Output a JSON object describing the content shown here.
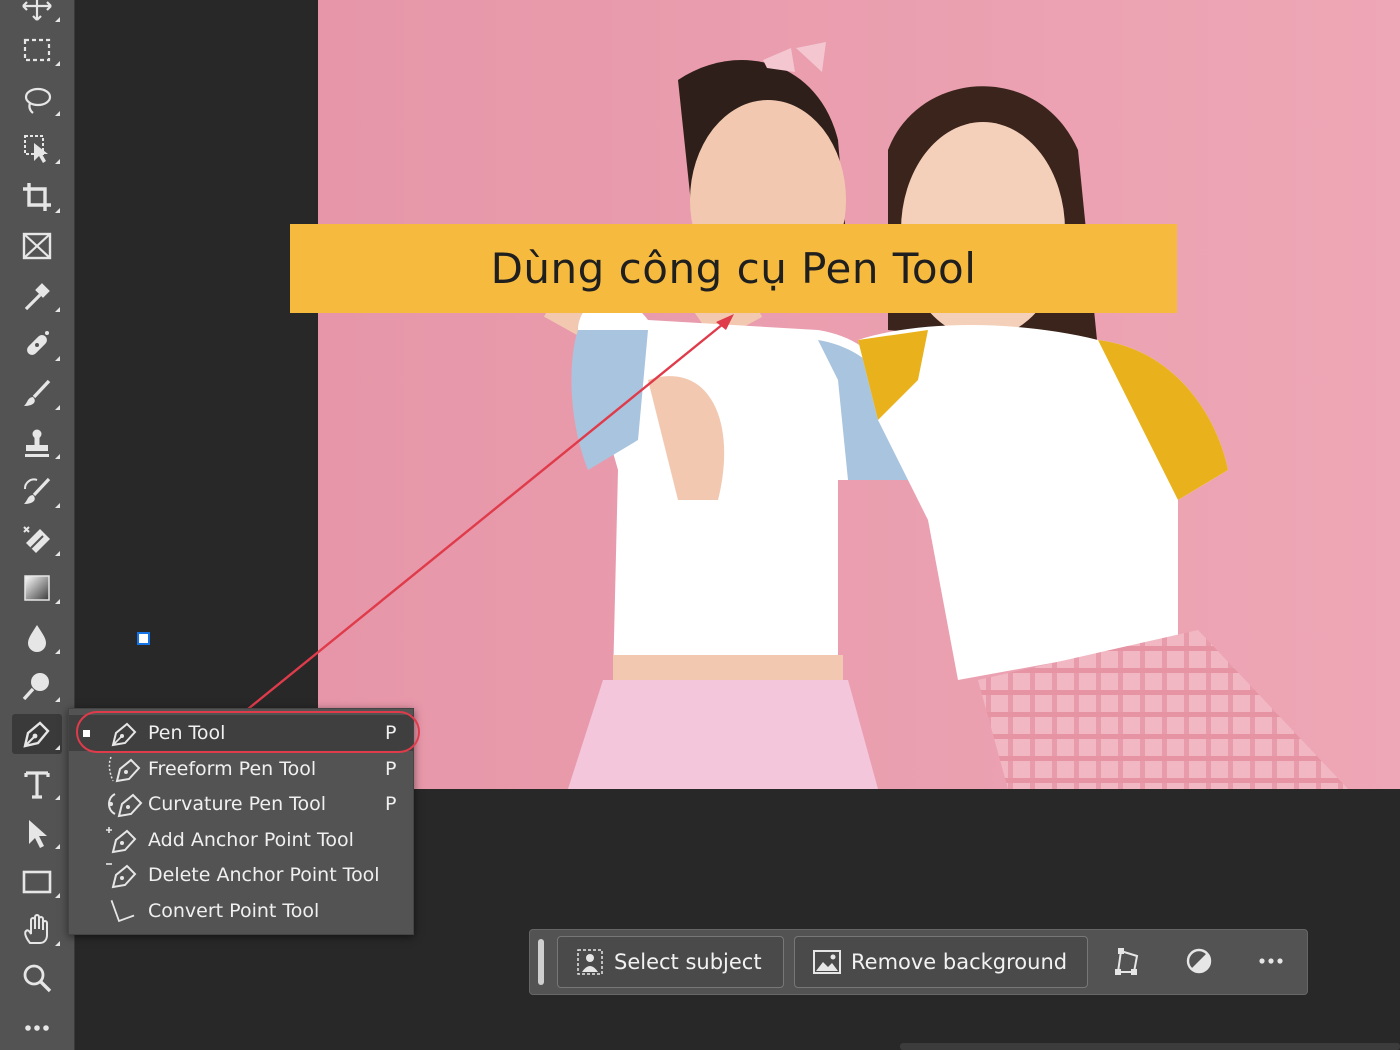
{
  "banner": {
    "text": "Dùng công cụ Pen Tool",
    "color": "#f6bb3e"
  },
  "annotation": {
    "color": "#e03b4b"
  },
  "toolbar": {
    "tools": [
      {
        "name": "move-icon"
      },
      {
        "name": "rectangular-marquee-icon"
      },
      {
        "name": "lasso-icon"
      },
      {
        "name": "object-selection-icon"
      },
      {
        "name": "crop-icon"
      },
      {
        "name": "frame-icon"
      },
      {
        "name": "eyedropper-icon"
      },
      {
        "name": "spot-healing-icon"
      },
      {
        "name": "brush-icon"
      },
      {
        "name": "clone-stamp-icon"
      },
      {
        "name": "history-brush-icon"
      },
      {
        "name": "eraser-icon"
      },
      {
        "name": "gradient-icon"
      },
      {
        "name": "blur-icon"
      },
      {
        "name": "dodge-icon"
      },
      {
        "name": "pen-icon",
        "active": true
      },
      {
        "name": "type-icon"
      },
      {
        "name": "path-selection-icon"
      },
      {
        "name": "rectangle-icon"
      },
      {
        "name": "hand-icon"
      },
      {
        "name": "zoom-icon"
      },
      {
        "name": "more-tools-icon"
      }
    ]
  },
  "pen_menu": {
    "items": [
      {
        "label": "Pen Tool",
        "shortcut": "P",
        "icon": "pen-icon",
        "selected": true
      },
      {
        "label": "Freeform Pen Tool",
        "shortcut": "P",
        "icon": "freeform-pen-icon"
      },
      {
        "label": "Curvature Pen Tool",
        "shortcut": "P",
        "icon": "curvature-pen-icon"
      },
      {
        "label": "Add Anchor Point Tool",
        "shortcut": "",
        "icon": "add-anchor-point-icon"
      },
      {
        "label": "Delete Anchor Point Tool",
        "shortcut": "",
        "icon": "delete-anchor-point-icon"
      },
      {
        "label": "Convert Point Tool",
        "shortcut": "",
        "icon": "convert-point-icon"
      }
    ]
  },
  "task_bar": {
    "select_subject": "Select subject",
    "remove_background": "Remove background"
  },
  "colors": {
    "canvas_bg": "#ec9fb0",
    "toolbar_bg": "#535353",
    "workspace_bg": "#282828"
  }
}
